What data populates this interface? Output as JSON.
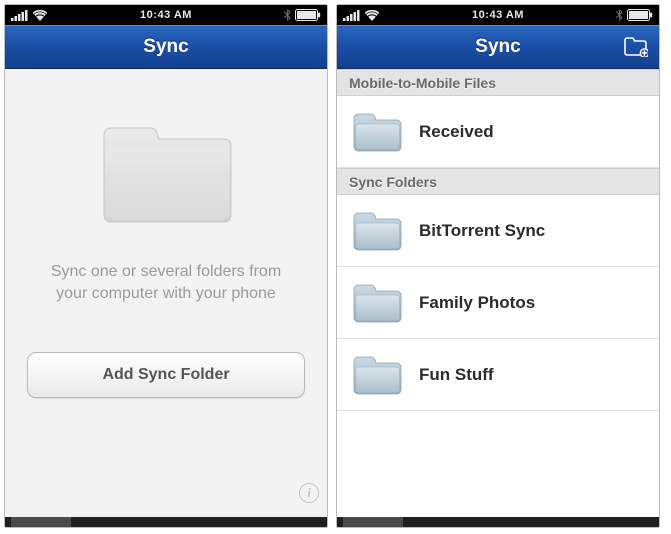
{
  "status": {
    "time": "10:43 AM"
  },
  "left": {
    "nav_title": "Sync",
    "empty_line1": "Sync one or several folders from",
    "empty_line2": "your computer with your phone",
    "add_button": "Add Sync Folder"
  },
  "right": {
    "nav_title": "Sync",
    "sections": [
      {
        "header": "Mobile-to-Mobile Files",
        "rows": [
          {
            "label": "Received"
          }
        ]
      },
      {
        "header": "Sync Folders",
        "rows": [
          {
            "label": "BitTorrent Sync"
          },
          {
            "label": "Family Photos"
          },
          {
            "label": "Fun Stuff"
          }
        ]
      }
    ]
  }
}
